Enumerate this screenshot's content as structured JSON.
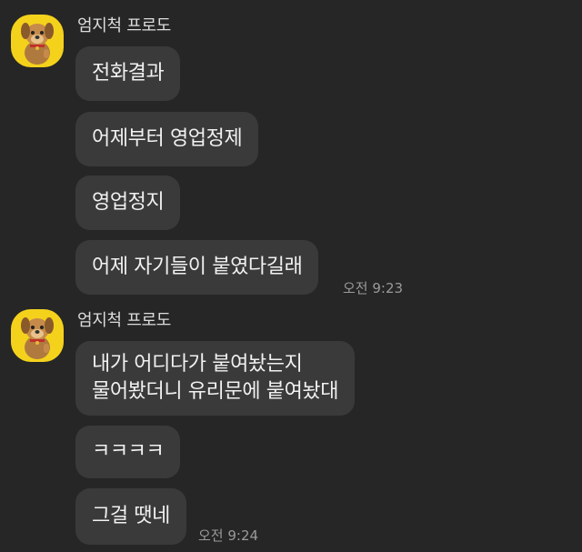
{
  "groups": [
    {
      "sender": "엄지척 프로도",
      "avatar_icon": "frodo-dog-thumbsup-icon",
      "messages": [
        "전화결과",
        "어제부터 영업정제",
        "영업정지",
        "어제 자기들이 붙였다길래"
      ],
      "time": "오전 9:23"
    },
    {
      "sender": "엄지척 프로도",
      "avatar_icon": "frodo-dog-thumbsup-icon",
      "messages": [
        "내가 어디다가 붙여놨는지\n물어봤더니 유리문에 붙여놨대",
        "ㅋㅋㅋㅋ",
        "그걸 땟네"
      ],
      "time": "오전 9:24"
    }
  ],
  "colors": {
    "background": "#262626",
    "bubble": "#3a3a3a",
    "avatar_bg": "#f4d21c",
    "text": "#f1f1f1",
    "time": "#9a9a9a"
  }
}
